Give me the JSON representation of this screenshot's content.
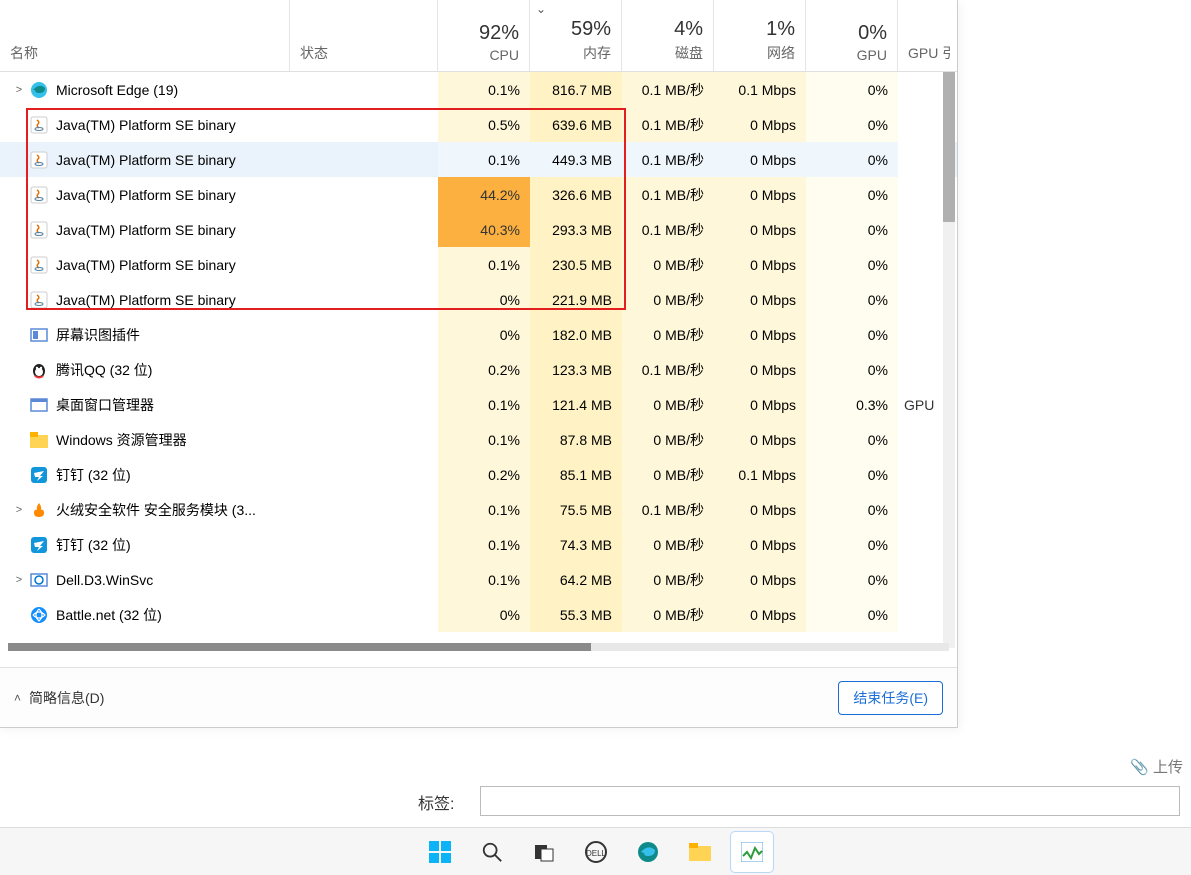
{
  "header": {
    "name_label": "名称",
    "state_label": "状态",
    "cpu_pct": "92%",
    "cpu_label": "CPU",
    "sort_glyph": "⌄",
    "mem_pct": "59%",
    "mem_label": "内存",
    "disk_pct": "4%",
    "disk_label": "磁盘",
    "net_pct": "1%",
    "net_label": "网络",
    "gpu_pct": "0%",
    "gpu_label": "GPU",
    "gpue_label": "GPU 引"
  },
  "rows": [
    {
      "icon": "edge",
      "expand": ">",
      "name": "Microsoft Edge (19)",
      "cpu": "0.1%",
      "cpu_hi": false,
      "mem": "816.7 MB",
      "disk": "0.1 MB/秒",
      "net": "0.1 Mbps",
      "gpu": "0%",
      "gpue": "",
      "sel": false
    },
    {
      "icon": "java",
      "expand": "",
      "name": "Java(TM) Platform SE binary",
      "cpu": "0.5%",
      "cpu_hi": false,
      "mem": "639.6 MB",
      "disk": "0.1 MB/秒",
      "net": "0 Mbps",
      "gpu": "0%",
      "gpue": "",
      "sel": false
    },
    {
      "icon": "java",
      "expand": "",
      "name": "Java(TM) Platform SE binary",
      "cpu": "0.1%",
      "cpu_hi": false,
      "mem": "449.3 MB",
      "disk": "0.1 MB/秒",
      "net": "0 Mbps",
      "gpu": "0%",
      "gpue": "",
      "sel": true
    },
    {
      "icon": "java",
      "expand": "",
      "name": "Java(TM) Platform SE binary",
      "cpu": "44.2%",
      "cpu_hi": true,
      "mem": "326.6 MB",
      "disk": "0.1 MB/秒",
      "net": "0 Mbps",
      "gpu": "0%",
      "gpue": "",
      "sel": false
    },
    {
      "icon": "java",
      "expand": "",
      "name": "Java(TM) Platform SE binary",
      "cpu": "40.3%",
      "cpu_hi": true,
      "mem": "293.3 MB",
      "disk": "0.1 MB/秒",
      "net": "0 Mbps",
      "gpu": "0%",
      "gpue": "",
      "sel": false
    },
    {
      "icon": "java",
      "expand": "",
      "name": "Java(TM) Platform SE binary",
      "cpu": "0.1%",
      "cpu_hi": false,
      "mem": "230.5 MB",
      "disk": "0 MB/秒",
      "net": "0 Mbps",
      "gpu": "0%",
      "gpue": "",
      "sel": false
    },
    {
      "icon": "java",
      "expand": "",
      "name": "Java(TM) Platform SE binary",
      "cpu": "0%",
      "cpu_hi": false,
      "mem": "221.9 MB",
      "disk": "0 MB/秒",
      "net": "0 Mbps",
      "gpu": "0%",
      "gpue": "",
      "sel": false
    },
    {
      "icon": "plugin",
      "expand": "",
      "name": "屏幕识图插件",
      "cpu": "0%",
      "cpu_hi": false,
      "mem": "182.0 MB",
      "disk": "0 MB/秒",
      "net": "0 Mbps",
      "gpu": "0%",
      "gpue": "",
      "sel": false
    },
    {
      "icon": "qq",
      "expand": "",
      "name": "腾讯QQ (32 位)",
      "cpu": "0.2%",
      "cpu_hi": false,
      "mem": "123.3 MB",
      "disk": "0.1 MB/秒",
      "net": "0 Mbps",
      "gpu": "0%",
      "gpue": "",
      "sel": false
    },
    {
      "icon": "dwm",
      "expand": "",
      "name": "桌面窗口管理器",
      "cpu": "0.1%",
      "cpu_hi": false,
      "mem": "121.4 MB",
      "disk": "0 MB/秒",
      "net": "0 Mbps",
      "gpu": "0.3%",
      "gpue": "GPU",
      "sel": false
    },
    {
      "icon": "explorer",
      "expand": "",
      "name": "Windows 资源管理器",
      "cpu": "0.1%",
      "cpu_hi": false,
      "mem": "87.8 MB",
      "disk": "0 MB/秒",
      "net": "0 Mbps",
      "gpu": "0%",
      "gpue": "",
      "sel": false
    },
    {
      "icon": "dingtalk",
      "expand": "",
      "name": "钉钉 (32 位)",
      "cpu": "0.2%",
      "cpu_hi": false,
      "mem": "85.1 MB",
      "disk": "0 MB/秒",
      "net": "0.1 Mbps",
      "gpu": "0%",
      "gpue": "",
      "sel": false
    },
    {
      "icon": "huorong",
      "expand": ">",
      "name": "火绒安全软件 安全服务模块 (3...",
      "cpu": "0.1%",
      "cpu_hi": false,
      "mem": "75.5 MB",
      "disk": "0.1 MB/秒",
      "net": "0 Mbps",
      "gpu": "0%",
      "gpue": "",
      "sel": false
    },
    {
      "icon": "dingtalk",
      "expand": "",
      "name": "钉钉 (32 位)",
      "cpu": "0.1%",
      "cpu_hi": false,
      "mem": "74.3 MB",
      "disk": "0 MB/秒",
      "net": "0 Mbps",
      "gpu": "0%",
      "gpue": "",
      "sel": false
    },
    {
      "icon": "dell",
      "expand": ">",
      "name": "Dell.D3.WinSvc",
      "cpu": "0.1%",
      "cpu_hi": false,
      "mem": "64.2 MB",
      "disk": "0 MB/秒",
      "net": "0 Mbps",
      "gpu": "0%",
      "gpue": "",
      "sel": false
    },
    {
      "icon": "battlenet",
      "expand": "",
      "name": "Battle.net (32 位)",
      "cpu": "0%",
      "cpu_hi": false,
      "mem": "55.3 MB",
      "disk": "0 MB/秒",
      "net": "0 Mbps",
      "gpu": "0%",
      "gpue": "",
      "sel": false
    }
  ],
  "footer": {
    "brief_info": "简略信息(D)",
    "end_task": "结束任务(E)"
  },
  "bg": {
    "tag_label": "标签:",
    "upload_label": "上传"
  },
  "colors": {
    "heat_low": "#fff7d9",
    "heat_med": "#fff2c4",
    "heat_high": "#fbb040",
    "selection": "#eaf3fb",
    "highlight_border": "#e31e1e"
  }
}
